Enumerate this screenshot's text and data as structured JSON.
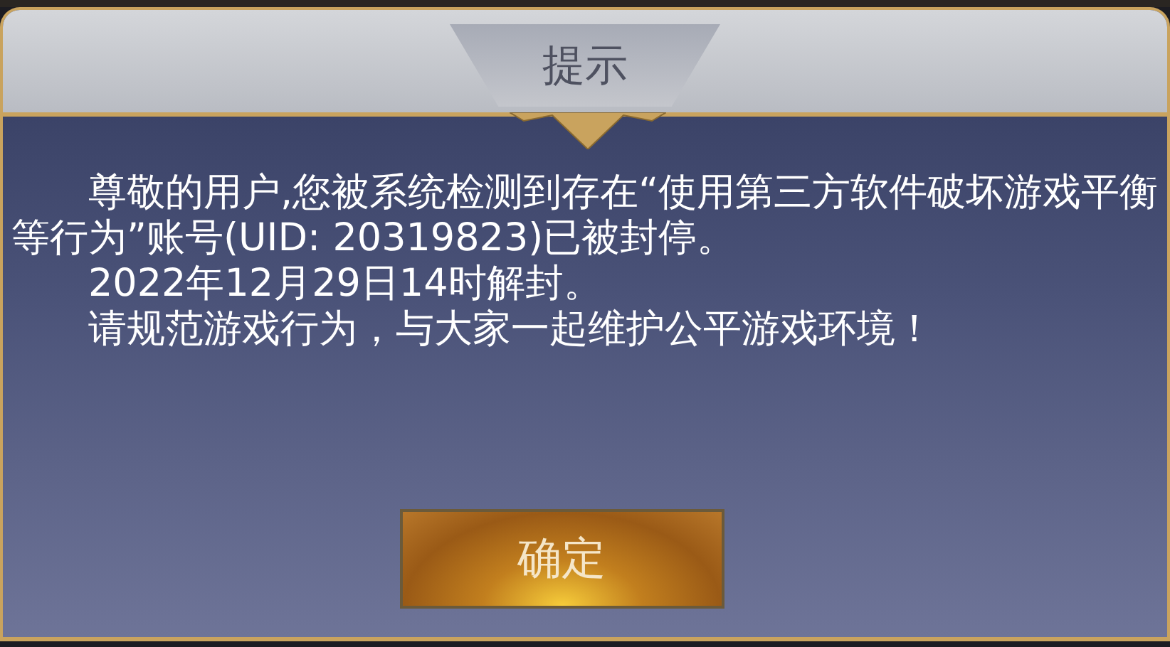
{
  "dialog": {
    "title": "提示",
    "paragraphs": [
      "尊敬的用户,您被系统检测到存在“使用第三方软件破坏游戏平衡等行为”账号(UID: 20319823)已被封停。",
      "2022年12月29日14时解封。",
      "请规范游戏行为，与大家一起维护公平游戏环境！"
    ],
    "button": "确定"
  }
}
